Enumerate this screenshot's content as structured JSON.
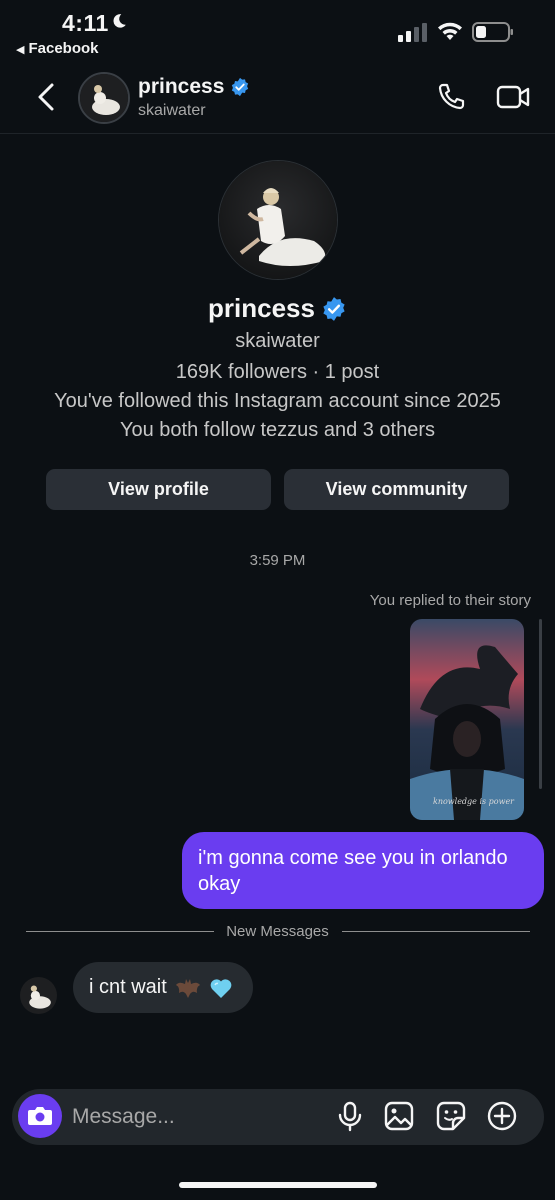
{
  "status_bar": {
    "time": "4:11",
    "back_app": "Facebook",
    "icons": [
      "moon-icon",
      "cellular-signal-icon",
      "wifi-icon",
      "battery-icon"
    ]
  },
  "header": {
    "name": "princess",
    "username": "skaiwater",
    "verified": true,
    "icons": [
      "back-arrow-icon",
      "phone-icon",
      "video-camera-icon"
    ]
  },
  "profile": {
    "name": "princess",
    "username": "skaiwater",
    "stats": "169K followers · 1 post",
    "followed_since": "You've followed this Instagram account since 2025",
    "mutual": "You both follow tezzus and 3 others",
    "buttons": {
      "view_profile": "View profile",
      "view_community": "View community"
    }
  },
  "conversation": {
    "timestamp": "3:59 PM",
    "story_reply_label": "You replied to their story",
    "story_caption": "knowledge is power",
    "outgoing_message": "i'm gonna come see you in orlando okay",
    "new_messages_divider": "New Messages",
    "incoming_message": "i cnt wait"
  },
  "composer": {
    "placeholder": "Message...",
    "icons": [
      "camera-icon",
      "microphone-icon",
      "gallery-icon",
      "sticker-icon",
      "plus-icon"
    ]
  },
  "colors": {
    "background": "#0c1014",
    "accent": "#6a3df0",
    "verified_blue": "#3897f0",
    "button_bg": "#2a2f36",
    "incoming_bubble": "#262b30"
  }
}
